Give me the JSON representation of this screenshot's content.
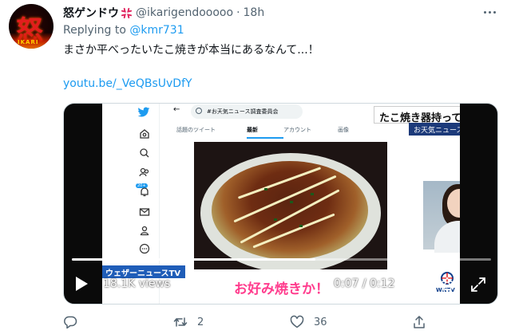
{
  "tweet": {
    "display_name": "怒ゲンドウ",
    "handle": "@ikarigendooooo",
    "separator": "·",
    "time": "18h",
    "replying_prefix": "Replying to",
    "replying_to": "@kmr731",
    "text": "まさか平べったいたこ焼きが本当にあるなんて...！",
    "link": "youtu.be/_VeQBsUvDfY"
  },
  "avatar": {
    "kanji": "怒",
    "small_text": "IKARI"
  },
  "video": {
    "banner_title": "たこ焼き器持ってますか？",
    "banner_sub": "お天気ニュース調査委員会",
    "search_query": "#お天気ニュース調査委員会",
    "tabs": [
      "話題のツイート",
      "最新",
      "アカウント",
      "画像"
    ],
    "notification_badge": "20+",
    "channel_label": "ウェザーニュースTV",
    "caption": "お好み焼きか！",
    "logo": "WNTV",
    "views": "18.1K views",
    "time_display": "0:07 / 0:12",
    "progress": 0.58
  },
  "actions": {
    "reply_count": "",
    "retweet_count": "2",
    "like_count": "36"
  },
  "colors": {
    "accent": "#1d9bf0",
    "text": "#0f1419",
    "secondary": "#536471"
  },
  "icons": [
    "anger-emoji-icon",
    "more-icon",
    "play-icon",
    "volume-icon",
    "settings-icon",
    "fullscreen-icon",
    "reply-icon",
    "retweet-icon",
    "like-icon",
    "share-icon"
  ]
}
